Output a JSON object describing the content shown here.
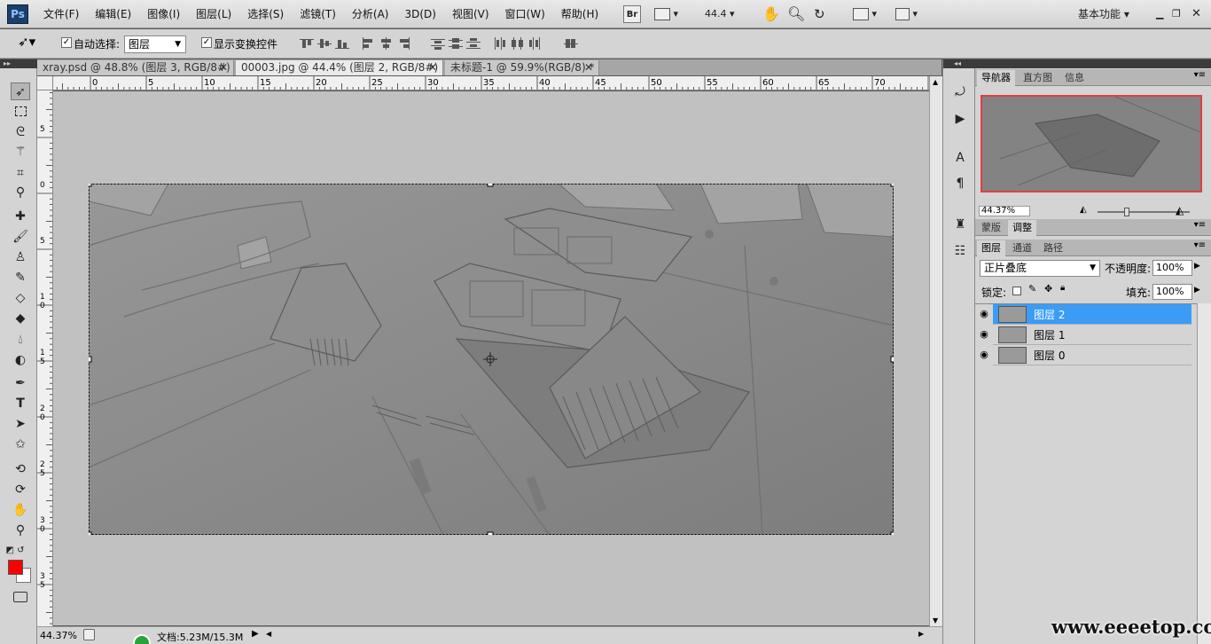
{
  "app": {
    "logo": "Ps"
  },
  "menu": [
    "文件(F)",
    "编辑(E)",
    "图像(I)",
    "图层(L)",
    "选择(S)",
    "滤镜(T)",
    "分析(A)",
    "3D(D)",
    "视图(V)",
    "窗口(W)",
    "帮助(H)"
  ],
  "menubar_right": {
    "bridge": "Br",
    "zoom": "44.4",
    "workspace": "基本功能"
  },
  "options": {
    "auto_select_label": "自动选择:",
    "auto_select_checked": true,
    "auto_select_target": "图层",
    "show_transform_label": "显示变换控件",
    "show_transform_checked": true
  },
  "tabs": [
    {
      "label": "xray.psd @ 48.8% (图层 3, RGB/8#) *",
      "active": false
    },
    {
      "label": "00003.jpg @ 44.4% (图层 2, RGB/8#) *",
      "active": true
    },
    {
      "label": "未标题-1 @ 59.9%(RGB/8) *",
      "active": false
    }
  ],
  "ruler_h": [
    "0",
    "5",
    "10",
    "15",
    "20",
    "25",
    "30",
    "35",
    "40",
    "45",
    "50",
    "55",
    "60",
    "65",
    "70"
  ],
  "ruler_v": [
    "5",
    "0",
    "5",
    "1 0",
    "1 5",
    "2 0",
    "2 5",
    "3 0",
    "3 5"
  ],
  "status": {
    "zoom": "44.37%",
    "doc": "文档:5.23M/15.3M"
  },
  "navigator": {
    "tabs": [
      "导航器",
      "直方图",
      "信息"
    ],
    "zoom": "44.37%"
  },
  "adjust_tabs": [
    "蒙版",
    "调整"
  ],
  "layers_panel": {
    "tabs": [
      "图层",
      "通道",
      "路径"
    ],
    "blend_mode": "正片叠底",
    "opacity_label": "不透明度:",
    "opacity": "100%",
    "lock_label": "锁定:",
    "fill_label": "填充:",
    "fill": "100%",
    "layers": [
      {
        "name": "图层 2",
        "selected": true,
        "visible": true
      },
      {
        "name": "图层 1",
        "selected": false,
        "visible": true
      },
      {
        "name": "图层 0",
        "selected": false,
        "visible": true
      }
    ]
  },
  "watermark": "www.eeeetop.com",
  "colors": {
    "foreground": "#ff0000",
    "background": "#ffffff",
    "selection": "#3a9cf5"
  }
}
